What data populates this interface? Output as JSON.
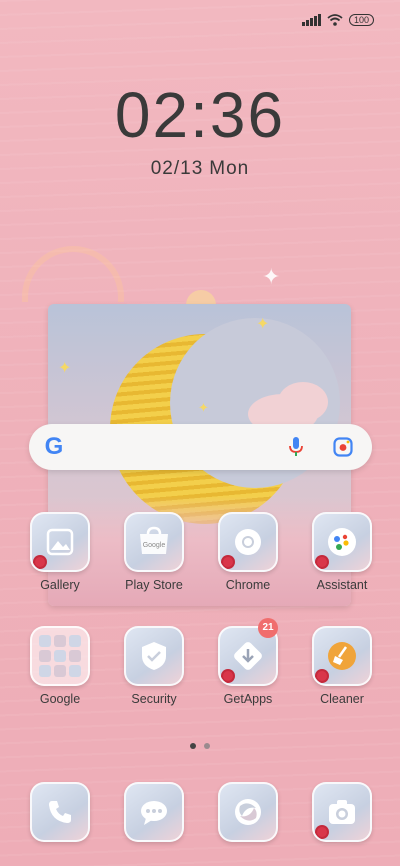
{
  "status_bar": {
    "battery": "100",
    "icons": [
      "signal-icon",
      "wifi-icon",
      "battery-icon"
    ]
  },
  "clock": {
    "time": "02:36",
    "date": "02/13",
    "weekday": "Mon"
  },
  "search_bar": {
    "logo": "G",
    "icons": [
      "mic-icon",
      "lens-icon"
    ]
  },
  "apps_row1": [
    {
      "label": "Gallery",
      "icon": "gallery-icon"
    },
    {
      "label": "Play Store",
      "icon": "play-store-icon",
      "tile_text": "Google"
    },
    {
      "label": "Chrome",
      "icon": "chrome-icon"
    },
    {
      "label": "Assistant",
      "icon": "assistant-icon"
    }
  ],
  "apps_row2": [
    {
      "label": "Google",
      "icon": "google-folder-icon"
    },
    {
      "label": "Security",
      "icon": "shield-icon"
    },
    {
      "label": "GetApps",
      "icon": "getapps-icon",
      "badge": "21"
    },
    {
      "label": "Cleaner",
      "icon": "broom-icon"
    }
  ],
  "dock": [
    {
      "icon": "phone-icon"
    },
    {
      "icon": "messages-icon"
    },
    {
      "icon": "browser-icon"
    },
    {
      "icon": "camera-icon"
    }
  ],
  "page_indicator": {
    "pages": 2,
    "current": 1
  },
  "colors": {
    "background": "#f0b4bd",
    "accent_yellow": "#f3cf4b",
    "badge": "#f06d6d",
    "text": "#3b3b3b"
  }
}
